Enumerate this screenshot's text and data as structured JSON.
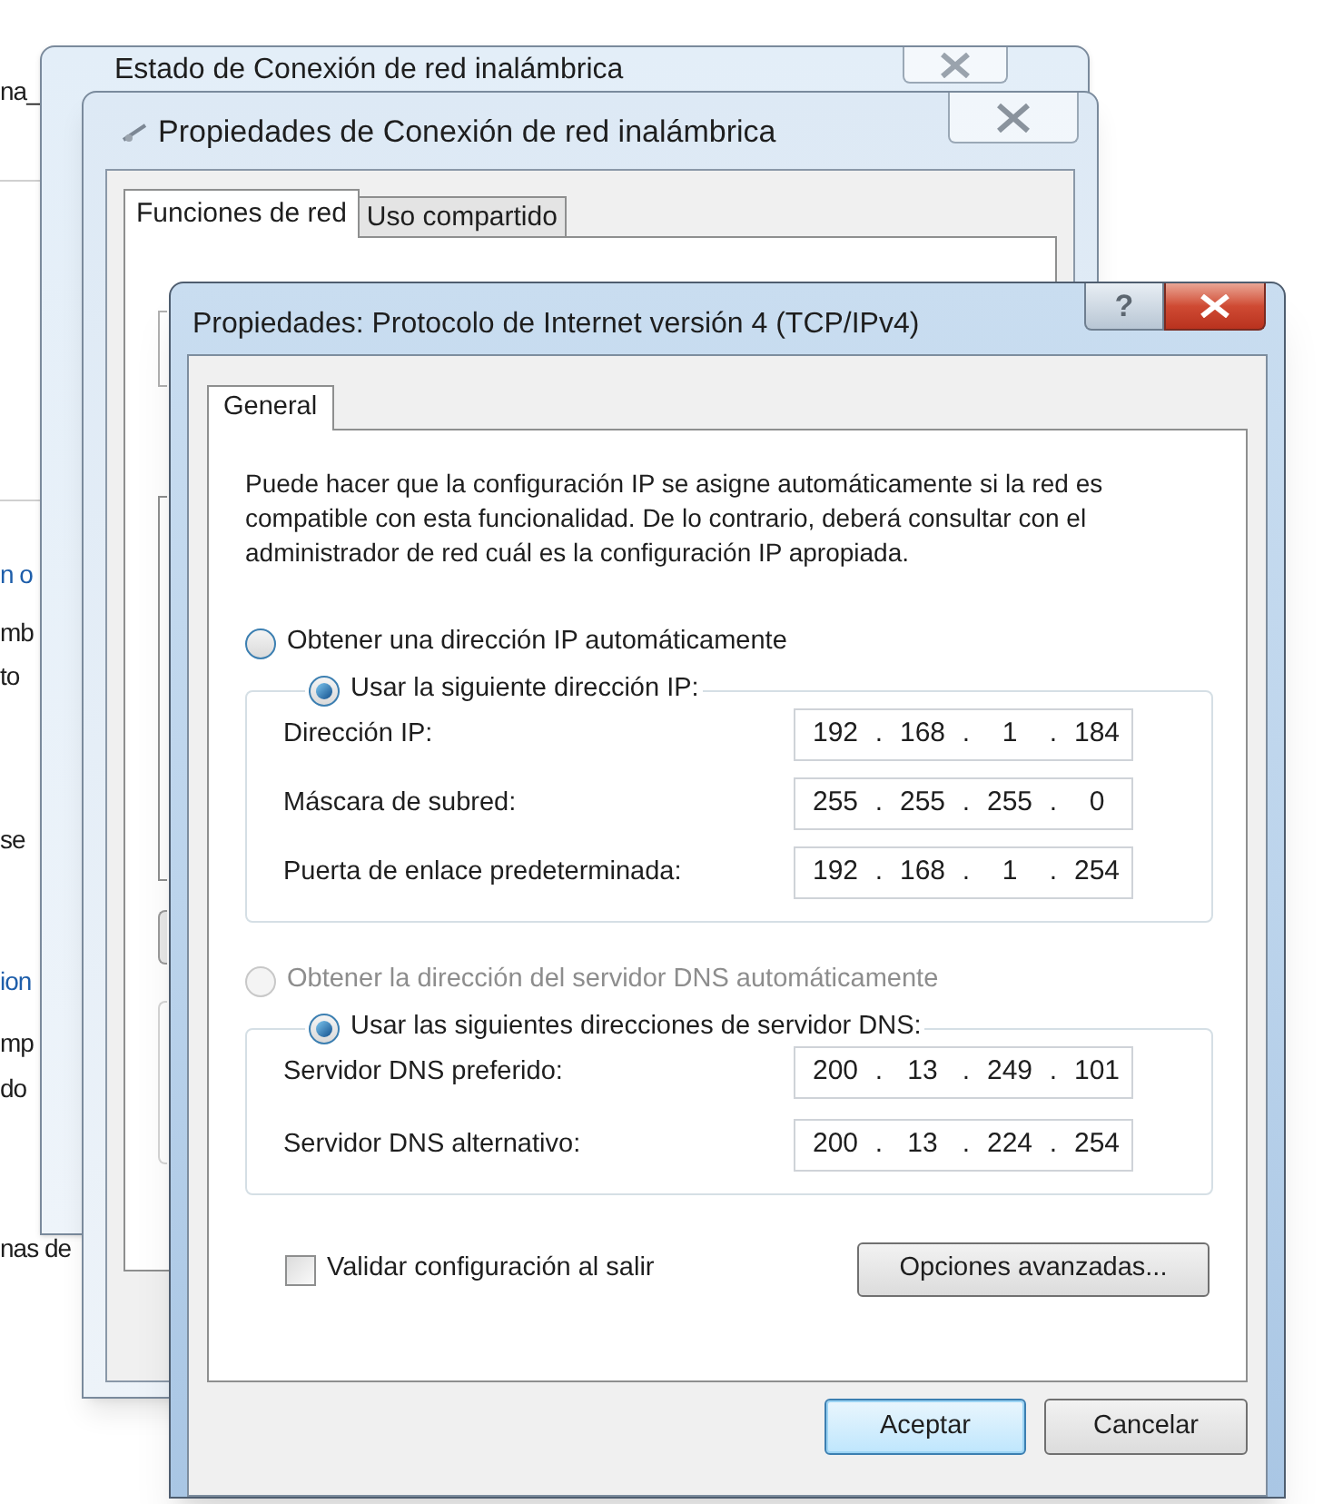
{
  "background_fragments": [
    {
      "text": "na_",
      "link": false
    },
    {
      "text": "n o",
      "link": true
    },
    {
      "text": "mb",
      "link": false
    },
    {
      "text": "to",
      "link": false
    },
    {
      "text": "se",
      "link": false
    },
    {
      "text": "ion",
      "link": true
    },
    {
      "text": "mp",
      "link": false
    },
    {
      "text": "do",
      "link": false
    },
    {
      "text": "nas de",
      "link": false
    }
  ],
  "status_window": {
    "title": "Estado de Conexión de red inalámbrica"
  },
  "properties_window": {
    "title": "Propiedades de Conexión de red inalámbrica",
    "tabs": [
      {
        "label": "Funciones de red",
        "selected": true
      },
      {
        "label": "Uso compartido",
        "selected": false
      }
    ]
  },
  "ipv4_dialog": {
    "title": "Propiedades: Protocolo de Internet versión 4 (TCP/IPv4)",
    "help_button": "?",
    "tabs": [
      {
        "label": "General",
        "selected": true
      }
    ],
    "description": "Puede hacer que la configuración IP se asigne automáticamente si la red es compatible con esta funcionalidad. De lo contrario, deberá consultar con el administrador de red cuál es la configuración IP apropiada.",
    "ip_auto": {
      "label": "Obtener una dirección IP automáticamente",
      "selected": false,
      "disabled": false
    },
    "ip_manual": {
      "label": "Usar la siguiente dirección IP:",
      "selected": true,
      "disabled": false
    },
    "ip_fields": [
      {
        "label": "Dirección IP:",
        "parts": [
          "192",
          ".",
          "168",
          ".",
          "1",
          ".",
          "184"
        ]
      },
      {
        "label": "Máscara de subred:",
        "parts": [
          "255",
          ".",
          "255",
          ".",
          "255",
          ".",
          "0"
        ]
      },
      {
        "label": "Puerta de enlace predeterminada:",
        "parts": [
          "192",
          ".",
          "168",
          ".",
          "1",
          ".",
          "254"
        ]
      }
    ],
    "dns_auto": {
      "label": "Obtener la dirección del servidor DNS automáticamente",
      "selected": false,
      "disabled": true
    },
    "dns_manual": {
      "label": "Usar las siguientes direcciones de servidor DNS:",
      "selected": true,
      "disabled": false
    },
    "dns_fields": [
      {
        "label": "Servidor DNS preferido:",
        "parts": [
          "200",
          ".",
          "13",
          ".",
          "249",
          ".",
          "101"
        ]
      },
      {
        "label": "Servidor DNS alternativo:",
        "parts": [
          "200",
          ".",
          "13",
          ".",
          "224",
          ".",
          "254"
        ]
      }
    ],
    "validate_checkbox": {
      "label": "Validar configuración al salir",
      "checked": false
    },
    "advanced_button": "Opciones avanzadas...",
    "buttons": [
      {
        "label": "Aceptar",
        "default": true
      },
      {
        "label": "Cancelar",
        "default": false
      }
    ]
  }
}
